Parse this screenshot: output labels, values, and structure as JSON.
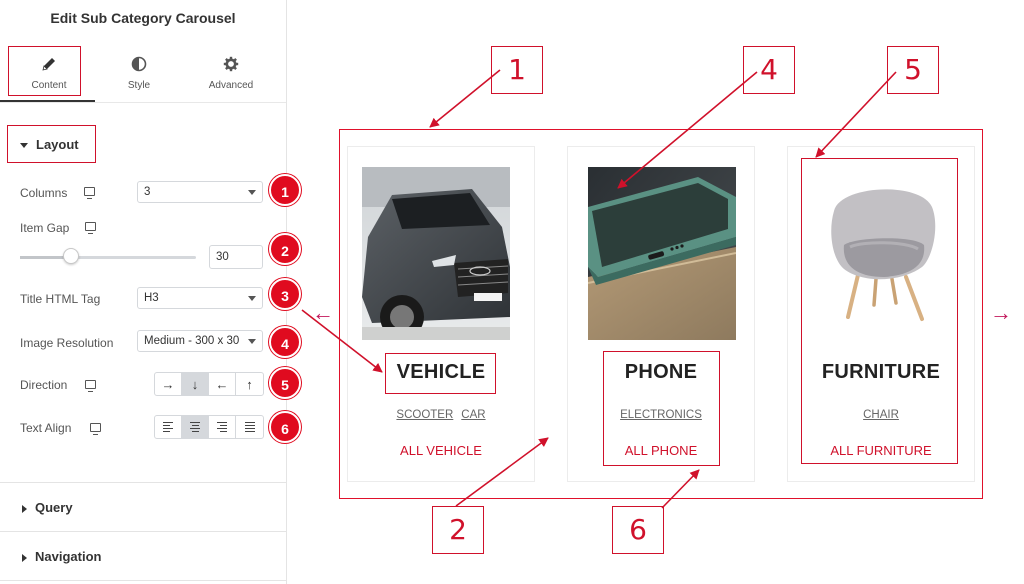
{
  "panel": {
    "title": "Edit Sub Category Carousel",
    "tabs": [
      {
        "label": "Content",
        "icon": "pencil-icon"
      },
      {
        "label": "Style",
        "icon": "contrast-icon"
      },
      {
        "label": "Advanced",
        "icon": "gear-icon"
      }
    ],
    "active_tab": "Content",
    "section": "Layout",
    "controls": {
      "columns": {
        "label": "Columns",
        "value": "3"
      },
      "item_gap": {
        "label": "Item Gap",
        "value": "30",
        "slider_fraction": 0.3
      },
      "title_tag": {
        "label": "Title HTML Tag",
        "value": "H3"
      },
      "image_resolution": {
        "label": "Image Resolution",
        "value": "Medium - 300 x 30"
      },
      "direction": {
        "label": "Direction",
        "buttons": [
          "→",
          "↓",
          "←",
          "↑"
        ],
        "active": 1
      },
      "text_align": {
        "label": "Text Align",
        "buttons": [
          "align-left-icon",
          "align-center-icon",
          "align-right-icon",
          "align-justify-icon"
        ],
        "active": 1
      }
    },
    "badges": [
      "1",
      "2",
      "3",
      "4",
      "5",
      "6"
    ],
    "collapsed_sections": [
      "Query",
      "Navigation"
    ]
  },
  "preview": {
    "cards": [
      {
        "title": "VEHICLE",
        "subs": [
          "SCOOTER",
          "CAR"
        ],
        "link": "ALL VEHICLE"
      },
      {
        "title": "PHONE",
        "subs": [
          "ELECTRONICS"
        ],
        "link": "ALL PHONE"
      },
      {
        "title": "FURNITURE",
        "subs": [
          "CHAIR"
        ],
        "link": "ALL FURNITURE"
      }
    ],
    "prev_arrow": "←",
    "next_arrow": "→",
    "callouts": [
      "1",
      "2",
      "4",
      "5",
      "6"
    ]
  },
  "colors": {
    "accent_red": "#d0112b",
    "badge_red": "#e00b1f",
    "arrow_pink": "#c2185b"
  }
}
